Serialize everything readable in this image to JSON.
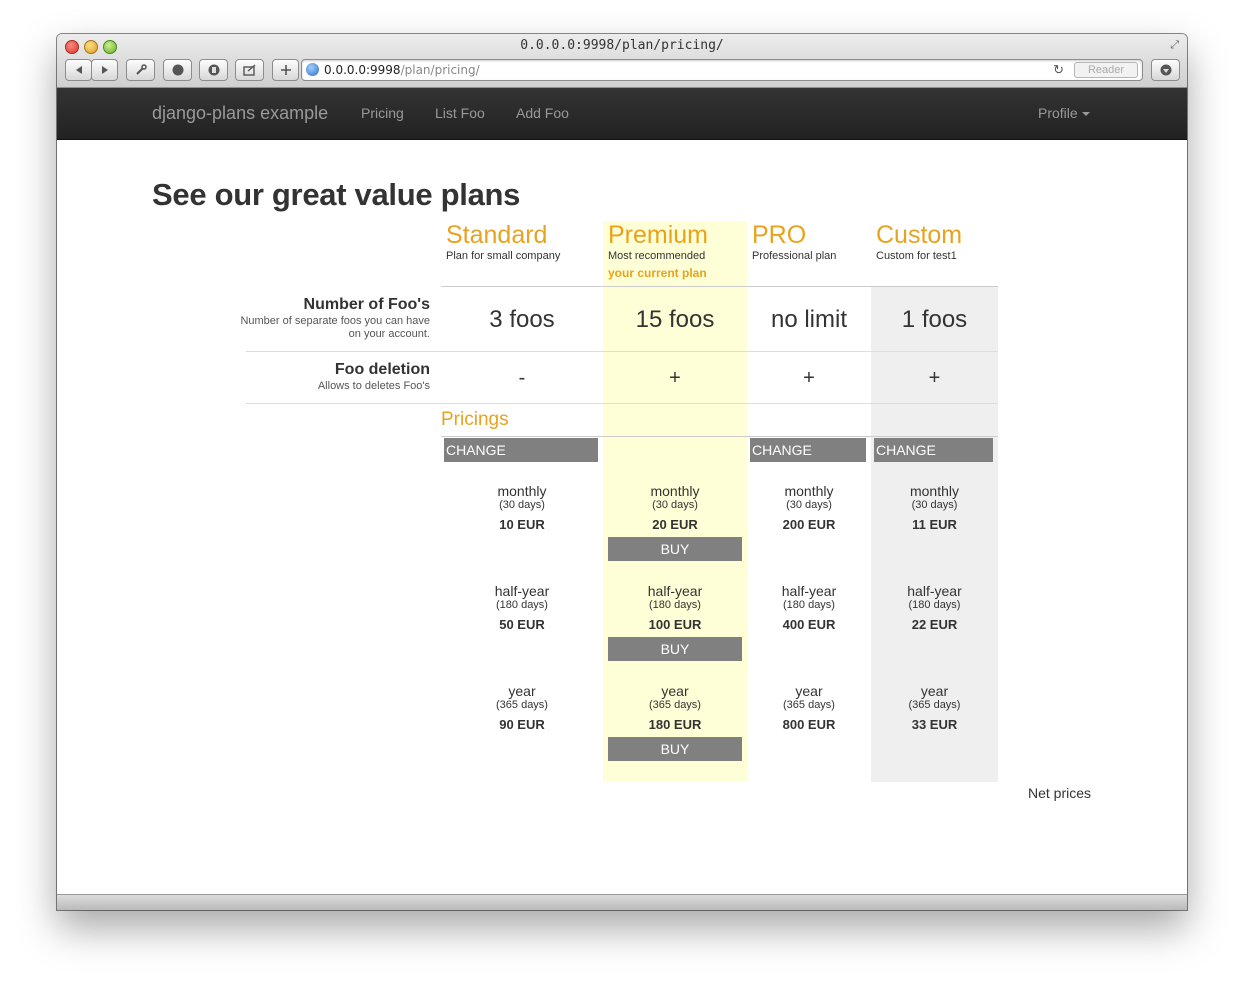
{
  "browser": {
    "window_title": "0.0.0.0:9998/plan/pricing/",
    "url_host": "0.0.0.0:9998",
    "url_path": "/plan/pricing/",
    "reader_label": "Reader",
    "reload_glyph": "↻",
    "fullscreen_glyph": "⤢"
  },
  "navbar": {
    "brand": "django-plans example",
    "items": [
      "Pricing",
      "List Foo",
      "Add Foo"
    ],
    "profile": "Profile"
  },
  "page": {
    "title": "See our great value plans",
    "pricings_label": "Pricings",
    "net_prices": "Net prices",
    "current_plan_label": "your current plan",
    "change_label": "CHANGE",
    "buy_label": "BUY"
  },
  "plans": [
    {
      "name": "Standard",
      "desc": "Plan for small company"
    },
    {
      "name": "Premium",
      "desc": "Most recommended"
    },
    {
      "name": "PRO",
      "desc": "Professional plan"
    },
    {
      "name": "Custom",
      "desc": "Custom for test1"
    }
  ],
  "features": [
    {
      "name": "Number of Foo's",
      "desc": "Number of separate foos you can have on your account.",
      "values": [
        "3 foos",
        "15 foos",
        "no limit",
        "1 foos"
      ]
    },
    {
      "name": "Foo deletion",
      "desc": "Allows to deletes Foo's",
      "values": [
        "-",
        "+",
        "+",
        "+"
      ]
    }
  ],
  "pricings": [
    {
      "period": "monthly",
      "days": "(30 days)",
      "prices": [
        "10 EUR",
        "20 EUR",
        "200 EUR",
        "11 EUR"
      ]
    },
    {
      "period": "half-year",
      "days": "(180 days)",
      "prices": [
        "50 EUR",
        "100 EUR",
        "400 EUR",
        "22 EUR"
      ]
    },
    {
      "period": "year",
      "days": "(365 days)",
      "prices": [
        "90 EUR",
        "180 EUR",
        "800 EUR",
        "33 EUR"
      ]
    }
  ],
  "colors": {
    "accent": "#e8a31e",
    "premium_highlight": "#ffffd7",
    "custom_highlight": "#efefef",
    "button_gray": "#808080",
    "navbar": "#222222"
  }
}
